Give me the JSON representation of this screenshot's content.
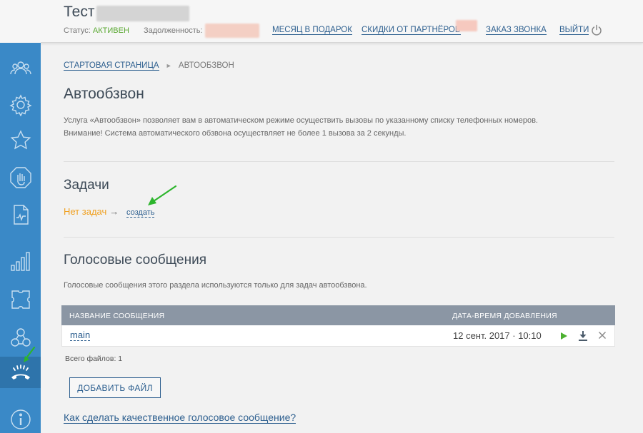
{
  "header": {
    "title": "Тест",
    "status_label": "Статус:",
    "status_value": "АКТИВЕН",
    "debt_label": "Задолженность:",
    "links": {
      "month_gift": "МЕСЯЦ В ПОДАРОК",
      "partner_discounts": "СКИДКИ ОТ ПАРТНЁРОВ",
      "order_call": "ЗАКАЗ ЗВОНКА",
      "exit": "ВЫЙТИ"
    }
  },
  "sidebar": {
    "items": [
      {
        "icon": "users-icon"
      },
      {
        "icon": "gear-icon"
      },
      {
        "icon": "star-icon"
      },
      {
        "icon": "hand-stop-icon"
      },
      {
        "icon": "document-chart-icon"
      },
      {
        "icon": "bar-chart-icon"
      },
      {
        "icon": "puzzle-icon"
      },
      {
        "icon": "network-icon"
      },
      {
        "icon": "phone-autodial-icon",
        "active": true
      },
      {
        "icon": "info-icon"
      }
    ]
  },
  "breadcrumb": {
    "home": "СТАРТОВАЯ СТРАНИЦА",
    "separator": "►",
    "current": "АВТООБЗВОН"
  },
  "page": {
    "title": "Автообзвон",
    "description_line1": "Услуга «Автообзвон» позволяет вам в автоматическом режиме осуществить вызовы по указанному списку телефонных номеров.",
    "description_line2": "Внимание! Система автоматического обзвона осуществляет не более 1 вызова за 2 секунды."
  },
  "tasks": {
    "title": "Задачи",
    "empty_text": "Нет задач",
    "arrow": "→",
    "create_link": "создать"
  },
  "voice": {
    "title": "Голосовые сообщения",
    "description": "Голосовые сообщения этого раздела используются только для задач автообзвона.",
    "table": {
      "col_name": "НАЗВАНИЕ СООБЩЕНИЯ",
      "col_date": "ДАТА-ВРЕМЯ ДОБАВЛЕНИЯ",
      "rows": [
        {
          "name": "main",
          "date": "12 сент. 2017 · 10:10"
        }
      ]
    },
    "total_files": "Всего файлов: 1",
    "add_file_button": "ДОБАВИТЬ ФАЙЛ",
    "howto_link": "Как сделать качественное голосовое сообщение?"
  },
  "colors": {
    "sidebar": "#3a89c7",
    "link": "#2d5f8f",
    "status_active": "#5aa832",
    "warning": "#f0a020",
    "table_header": "#8b96a4",
    "annotation_arrow": "#2cb52c"
  }
}
